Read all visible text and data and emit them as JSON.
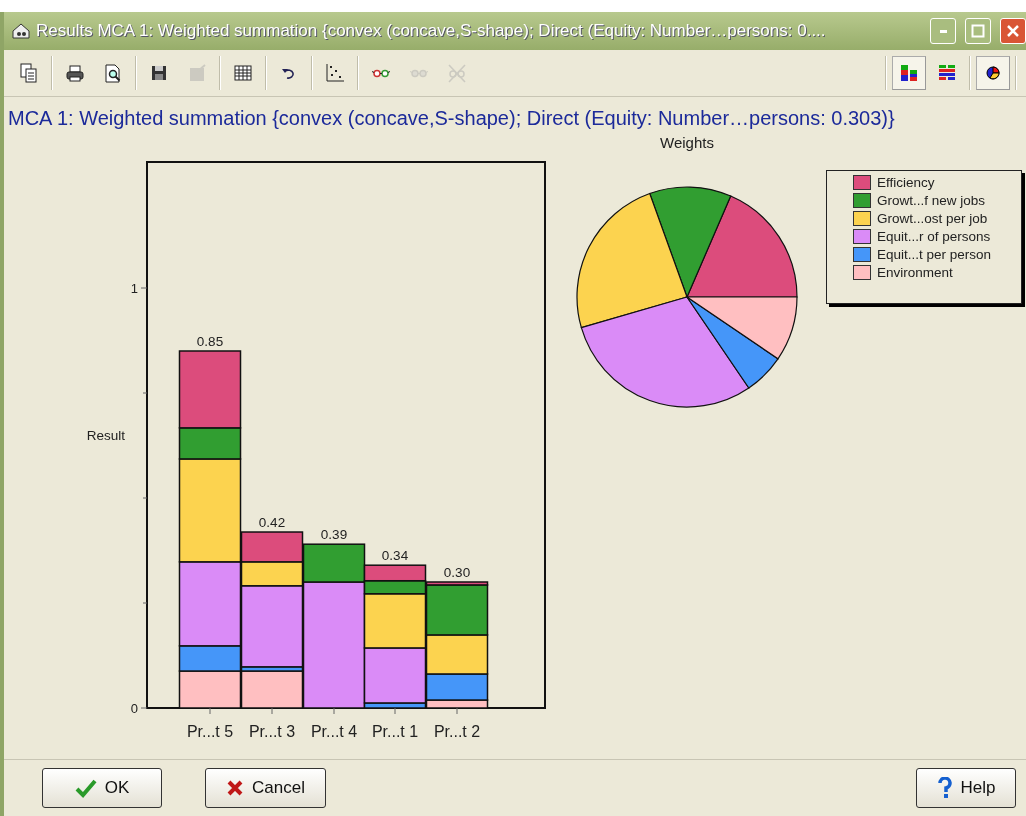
{
  "window": {
    "title": "Results MCA 1: Weighted summation {convex (concave,S-shape); Direct (Equity: Number…persons: 0...."
  },
  "toolbar": {
    "left": [
      {
        "kind": "copy",
        "disabled": false
      },
      {
        "kind": "print",
        "disabled": false
      },
      {
        "kind": "preview",
        "disabled": false
      },
      {
        "kind": "save",
        "disabled": false
      },
      {
        "kind": "export",
        "disabled": true
      },
      {
        "kind": "table",
        "disabled": false
      },
      {
        "kind": "undo",
        "disabled": false
      },
      {
        "kind": "scatter",
        "disabled": false
      },
      {
        "kind": "glasses",
        "disabled": false
      },
      {
        "kind": "glasses",
        "disabled": true
      },
      {
        "kind": "glasses-cross",
        "disabled": true
      }
    ],
    "right": [
      {
        "kind": "stacked",
        "selected": true
      },
      {
        "kind": "rows",
        "selected": false
      },
      {
        "kind": "pie",
        "selected": true
      }
    ]
  },
  "heading": "MCA 1: Weighted summation {convex (concave,S-shape); Direct (Equity: Number…persons: 0.303)}",
  "results": {
    "chart_data": {
      "type": "bar",
      "stacked": true,
      "ylabel": "Result",
      "ylim": [
        0,
        1.3
      ],
      "yticks": [
        0,
        1
      ],
      "categories": [
        "Pr...t 5",
        "Pr...t 3",
        "Pr...t 4",
        "Pr...t 1",
        "Pr...t 2"
      ],
      "value_labels": [
        "0.85",
        "0.42",
        "0.39",
        "0.34",
        "0.30"
      ],
      "series": [
        {
          "color": "#ffbfc1",
          "values": [
            0.088,
            0.088,
            0,
            0,
            0.019
          ]
        },
        {
          "color": "#4596f9",
          "values": [
            0.06,
            0.01,
            0,
            0.012,
            0.062
          ]
        },
        {
          "color": "#da8bf7",
          "values": [
            0.2,
            0.193,
            0.3,
            0.131,
            0
          ]
        },
        {
          "color": "#fcd34f",
          "values": [
            0.245,
            0.057,
            0,
            0.129,
            0.093
          ]
        },
        {
          "color": "#319e31",
          "values": [
            0.074,
            0,
            0.09,
            0.031,
            0.119
          ]
        },
        {
          "color": "#dc4c7c",
          "values": [
            0.183,
            0.071,
            0,
            0.037,
            0.007
          ]
        }
      ]
    }
  },
  "weights": {
    "chart_data": {
      "type": "pie",
      "title": "Weights",
      "categories": [
        "Efficiency",
        "Growt...f new jobs",
        "Growt...ost per job",
        "Equit...r of persons",
        "Equit...t per person",
        "Environment"
      ],
      "values": [
        0.185,
        0.12,
        0.24,
        0.3,
        0.06,
        0.095
      ],
      "colors": [
        "#dc4c7c",
        "#319e31",
        "#fcd34f",
        "#da8bf7",
        "#4596f9",
        "#ffbfc1"
      ]
    }
  },
  "buttons": [
    {
      "kind": "ok",
      "label": "OK"
    },
    {
      "kind": "cancel",
      "label": "Cancel"
    },
    {
      "kind": "help",
      "label": "Help"
    }
  ]
}
